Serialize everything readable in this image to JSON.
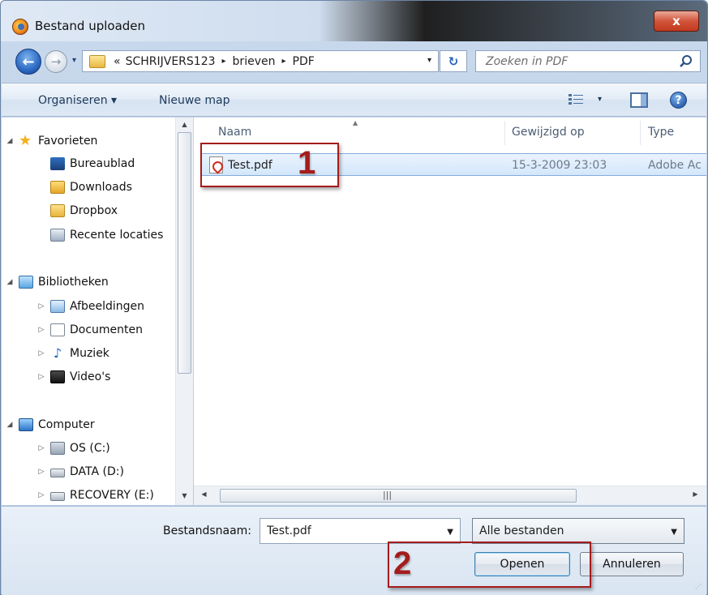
{
  "window": {
    "title": "Bestand uploaden",
    "close_glyph": "x"
  },
  "address": {
    "history_glyph": "▾",
    "prefix": "«",
    "crumbs": [
      "SCHRIJVERS123",
      "brieven",
      "PDF"
    ],
    "separator": "▸",
    "dropdown_glyph": "▾",
    "refresh_glyph": "↻",
    "search_placeholder": "Zoeken in PDF"
  },
  "toolbar": {
    "organize": "Organiseren ▾",
    "new_folder": "Nieuwe map",
    "view_dropdown_glyph": "▾",
    "help_glyph": "?"
  },
  "nav": {
    "favorites": {
      "label": "Favorieten",
      "items": [
        "Bureaublad",
        "Downloads",
        "Dropbox",
        "Recente locaties"
      ]
    },
    "libraries": {
      "label": "Bibliotheken",
      "items": [
        "Afbeeldingen",
        "Documenten",
        "Muziek",
        "Video's"
      ]
    },
    "computer": {
      "label": "Computer",
      "items": [
        "OS (C:)",
        "DATA (D:)",
        "RECOVERY (E:)"
      ]
    },
    "expanded_glyph": "◢",
    "collapsed_glyph": "▷"
  },
  "file_list": {
    "columns": [
      "Naam",
      "Gewijzigd op",
      "Type"
    ],
    "rows": [
      {
        "name": "Test.pdf",
        "modified": "15-3-2009 23:03",
        "type": "Adobe Ac"
      }
    ]
  },
  "footer": {
    "filename_label": "Bestandsnaam:",
    "filename_value": "Test.pdf",
    "filter_value": "Alle bestanden",
    "open_button": "Openen",
    "cancel_button": "Annuleren"
  },
  "callouts": [
    "1",
    "2"
  ],
  "colors": {
    "accent": "#a51c1c",
    "selection": "#d4e7fb",
    "frame": "#b7cce6"
  }
}
